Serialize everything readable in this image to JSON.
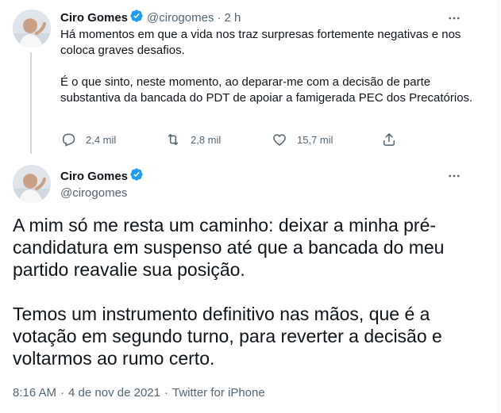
{
  "tweet1": {
    "author_name": "Ciro Gomes",
    "handle": "@cirogomes",
    "separator": "·",
    "time": "2 h",
    "paragraphs": [
      "Há momentos em que a vida nos traz surpresas fortemente negativas e nos coloca graves desafios.",
      "É o que sinto, neste momento, ao deparar-me com a decisão de parte substantiva da bancada do PDT de apoiar a famigerada PEC dos Precatórios."
    ],
    "replies": "2,4 mil",
    "retweets": "2,8 mil",
    "likes": "15,7 mil",
    "icons": {
      "reply": "reply-icon",
      "retweet": "retweet-icon",
      "like": "heart-icon",
      "share": "share-icon",
      "more": "more-dots-icon",
      "verified": "verified-badge-icon"
    }
  },
  "tweet2": {
    "author_name": "Ciro Gomes",
    "handle": "@cirogomes",
    "paragraphs": [
      "A mim só me resta um caminho: deixar a minha pré-candidatura em suspenso até que a bancada do meu partido reavalie sua posição.",
      "Temos um instrumento definitivo nas mãos, que é a votação em segundo turno, para  reverter a decisão e voltarmos ao rumo certo."
    ],
    "time": "8:16 AM",
    "date": "4 de nov de 2021",
    "separator": "·",
    "source": "Twitter for iPhone"
  },
  "colors": {
    "text": "#0f1419",
    "muted": "#536471",
    "verified": "#1d9bf0",
    "thread_line": "#cfd9de"
  }
}
